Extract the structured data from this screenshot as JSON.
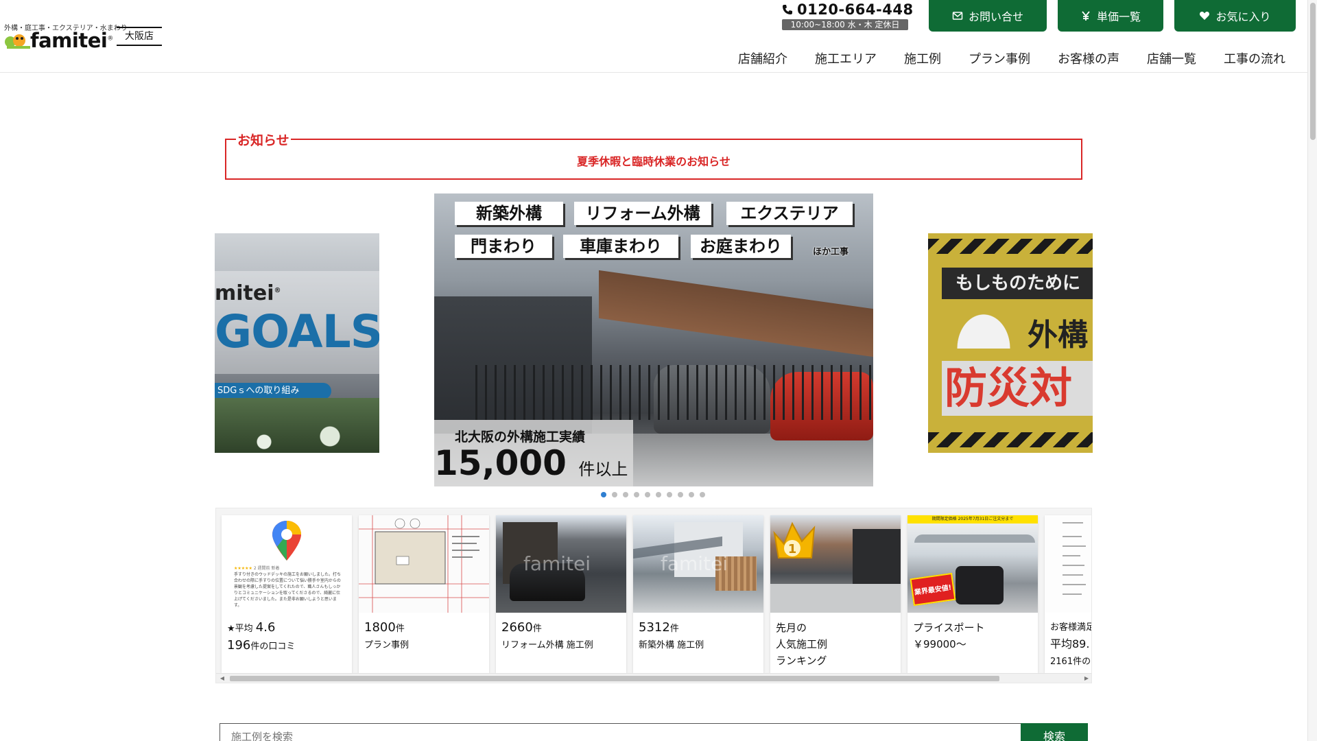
{
  "header": {
    "logo_tagline": "外構・庭工事・エクステリア・水まわり",
    "logo_name": "famitei",
    "logo_reg": "®",
    "store_name": "大阪店",
    "phone": "0120-664-448",
    "hours": "10:00~18:00 水・木 定休日",
    "buttons": {
      "contact": "お問い合せ",
      "price_list": "単価一覧",
      "favorites": "お気に入り"
    },
    "nav": [
      "店舗紹介",
      "施工エリア",
      "施工例",
      "プラン事例",
      "お客様の声",
      "店舗一覧",
      "工事の流れ"
    ]
  },
  "notice": {
    "title": "お知らせ",
    "link": "夏季休暇と臨時休業のお知らせ"
  },
  "carousel": {
    "left_slide": {
      "brand": "mitei",
      "brand_reg": "®",
      "headline": "GOALS",
      "pill": "SDGｓへの取り組み"
    },
    "main_slide": {
      "tags": [
        "新築外構",
        "リフォーム外構",
        "エクステリア",
        "門まわり",
        "車庫まわり",
        "お庭まわり"
      ],
      "tag_extra": "ほか工事",
      "record_label": "北大阪の外構施工実績",
      "record_count": "15,000",
      "record_unit": "件以上"
    },
    "right_slide": {
      "line1": "もしものために",
      "line2": "外構",
      "line3": "防災対"
    },
    "dot_count": 10,
    "active_dot": 0
  },
  "cards": [
    {
      "id": "reviews",
      "line1_prefix": "★平均 ",
      "line1_value": "4.6",
      "line2_value": "196",
      "line2_suffix": "件の口コミ"
    },
    {
      "id": "plans",
      "value": "1800",
      "unit": "件",
      "label": "プラン事例"
    },
    {
      "id": "reform",
      "value": "2660",
      "unit": "件",
      "label": "リフォーム外構 施工例"
    },
    {
      "id": "new",
      "value": "5312",
      "unit": "件",
      "label": "新築外構 施工例"
    },
    {
      "id": "ranking",
      "lines": [
        "先月の",
        "人気施工例",
        "ランキング"
      ]
    },
    {
      "id": "price",
      "lines": [
        "プライスポート",
        "￥99000～"
      ],
      "badge": "業界最安値!",
      "banner": "期間限定価格 2025年7月31日ご注文分まで"
    },
    {
      "id": "satisfaction",
      "lines": [
        "お客様満足度",
        "平均89.",
        "2161件の"
      ]
    }
  ],
  "maps_card_review": "手すり付きのウッドデッキの施工をお願いしました。打ち合わせの際に手すりの位置について悩い勝手や室内からの景観を考慮した提案をしてくれたので、職人さんもしっかりとコミュニケーションを取ってくださるので、綺麗に仕上げてくださいました。また是非お願いしようと思います。",
  "maps_card_meta": "2 週間前 新着",
  "ranking_badge": "1",
  "watermark": "famitei",
  "search": {
    "placeholder": "施工例を検索",
    "button": "検索"
  },
  "colors": {
    "brand_green": "#0f6b35",
    "notice_red": "#d92626",
    "dot_active": "#2f7fd1"
  }
}
